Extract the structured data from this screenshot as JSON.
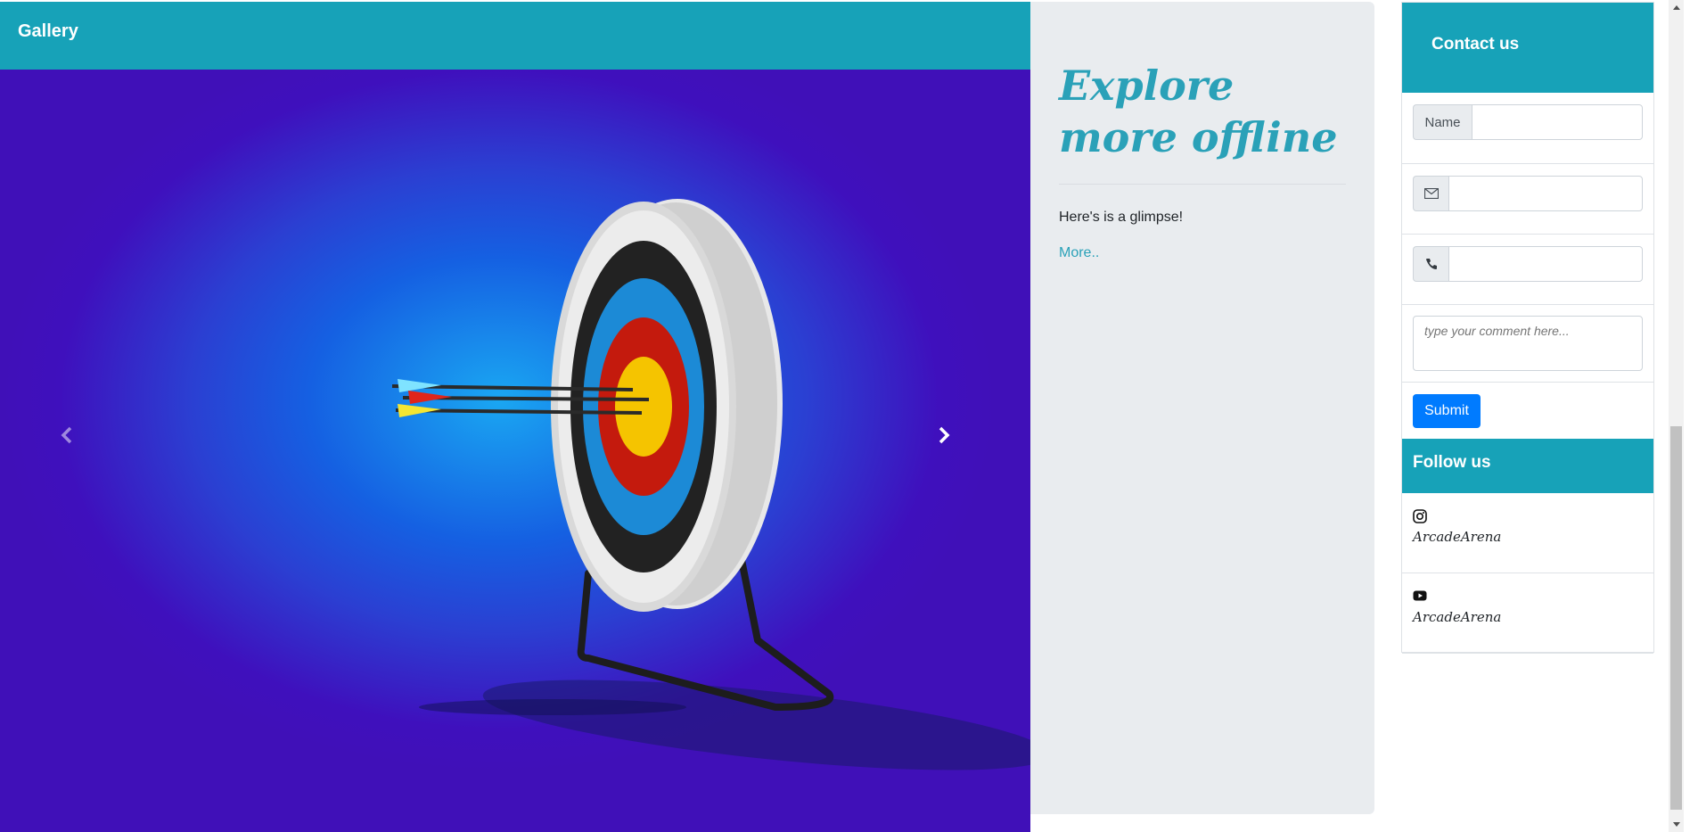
{
  "gallery": {
    "title": "Gallery",
    "prev_label": "Previous",
    "next_label": "Next"
  },
  "explore": {
    "heading": "Explore more offline",
    "text": "Here's is a glimpse!",
    "link": "More.."
  },
  "contact": {
    "title": "Contact us",
    "name_label": "Name",
    "email_icon": "envelope-icon",
    "phone_icon": "phone-icon",
    "comment_placeholder": "type your comment here...",
    "submit_label": "Submit"
  },
  "follow": {
    "title": "Follow us",
    "items": [
      {
        "icon": "instagram-icon",
        "name": "ArcadeArena"
      },
      {
        "icon": "youtube-icon",
        "name": "ArcadeArena"
      }
    ]
  },
  "colors": {
    "header": "#17a2b8",
    "accent_text": "#2aa1b8",
    "submit": "#007bff",
    "panel": "#e9ecef"
  }
}
